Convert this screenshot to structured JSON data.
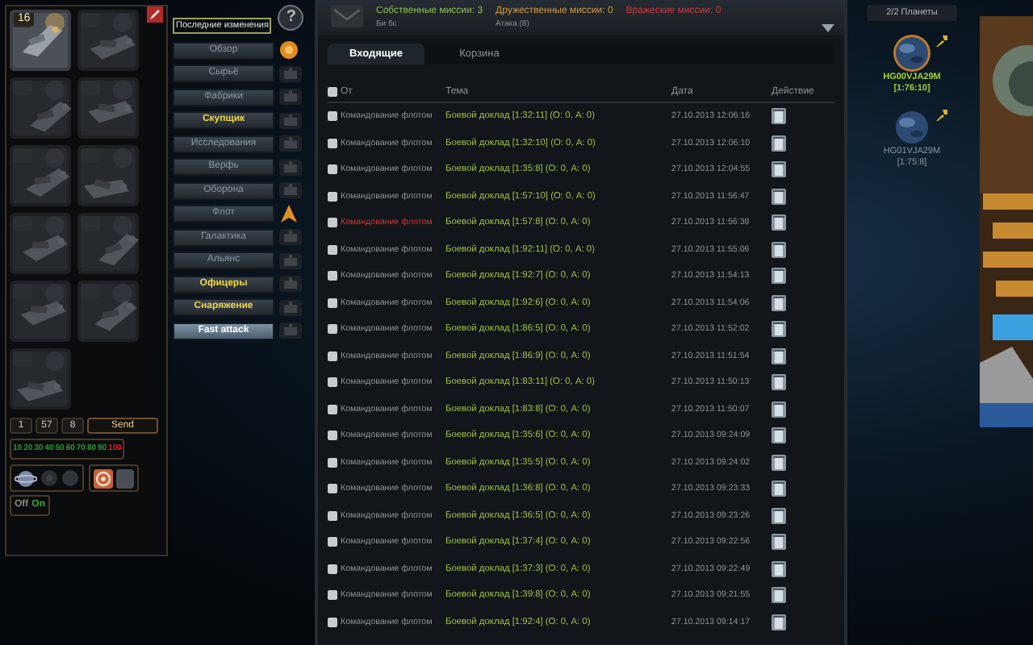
{
  "left_panel": {
    "thumbnails": [
      {
        "kind": "picture",
        "badge": "16"
      },
      {
        "kind": "picture"
      },
      {
        "kind": "picture"
      },
      {
        "kind": "picture"
      },
      {
        "kind": "picture"
      },
      {
        "kind": "picture"
      },
      {
        "kind": "picture"
      },
      {
        "kind": "picture"
      },
      {
        "kind": "picture"
      },
      {
        "kind": "picture"
      },
      {
        "kind": "picture"
      }
    ],
    "fleet_inputs": [
      {
        "value": "1"
      },
      {
        "value": "57"
      },
      {
        "value": "8"
      }
    ],
    "send_button": "Send",
    "percentages": [
      {
        "text": "10",
        "color": "#2e9a36"
      },
      {
        "text": "20",
        "color": "#2e9a36"
      },
      {
        "text": "30",
        "color": "#2e9a36"
      },
      {
        "text": "40",
        "color": "#2e9a36"
      },
      {
        "text": "50",
        "color": "#2e9a36"
      },
      {
        "text": "60",
        "color": "#2e9a36"
      },
      {
        "text": "70",
        "color": "#2e9a36"
      },
      {
        "text": "80",
        "color": "#2e9a36"
      },
      {
        "text": "90",
        "color": "#2e9a36"
      },
      {
        "text": "100",
        "color": "#e0242a"
      }
    ],
    "toggle": {
      "off_label": "Off",
      "on_label": "On",
      "on": true
    }
  },
  "menu": {
    "recent_changes": "Последние изменения",
    "help": "?",
    "items": [
      {
        "label": "Обзор",
        "kind": "normal"
      },
      {
        "label": "Сырьё",
        "kind": "normal"
      },
      {
        "label": "Фабрики",
        "kind": "normal"
      },
      {
        "label": "Скупщик",
        "kind": "highlight"
      },
      {
        "label": "Исследования",
        "kind": "normal"
      },
      {
        "label": "Верфь",
        "kind": "normal"
      },
      {
        "label": "Оборона",
        "kind": "normal"
      },
      {
        "label": "Флот",
        "kind": "normal"
      },
      {
        "label": "Галактика",
        "kind": "normal"
      },
      {
        "label": "Альянс",
        "kind": "normal"
      },
      {
        "label": "Офицеры",
        "kind": "highlight"
      },
      {
        "label": "Снаряжение",
        "kind": "highlight"
      },
      {
        "label": "Fast attack",
        "kind": "action"
      }
    ]
  },
  "missions": {
    "own": "Собственные миссии: 3",
    "own_detail": "Би бс",
    "friendly": "Дружественные миссии: 0",
    "friendly_detail": "Атака (8)",
    "hostile": "Вражеские миссии: 0"
  },
  "tabs": [
    {
      "label": "Входящие",
      "selected": true
    },
    {
      "label": "Корзина",
      "selected": false
    }
  ],
  "table": {
    "columns": [
      "От",
      "Тема",
      "Дата",
      "Действие"
    ],
    "all_checked": false,
    "rows": [
      {
        "checked": false,
        "flagged": false,
        "from": "Командование флотом",
        "subject": "Боевой доклад [1:32:11] (О: 0, А: 0)",
        "date": "27.10.2013 12:06:16"
      },
      {
        "checked": false,
        "flagged": false,
        "from": "Командование флотом",
        "subject": "Боевой доклад [1:32:10] (О: 0, А: 0)",
        "date": "27.10.2013 12:06:10"
      },
      {
        "checked": false,
        "flagged": false,
        "from": "Командование флотом",
        "subject": "Боевой доклад [1:35:8] (О: 0, А: 0)",
        "date": "27.10.2013 12:04:55"
      },
      {
        "checked": false,
        "flagged": false,
        "from": "Командование флотом",
        "subject": "Боевой доклад [1:57:10] (О: 0, А: 0)",
        "date": "27.10.2013 11:56:47"
      },
      {
        "checked": false,
        "flagged": true,
        "from": "Командование флотом",
        "subject": "Боевой доклад [1:57:8] (О: 0, А: 0)",
        "date": "27.10.2013 11:56:38"
      },
      {
        "checked": false,
        "flagged": false,
        "from": "Командование флотом",
        "subject": "Боевой доклад [1:92:11] (О: 0, А: 0)",
        "date": "27.10.2013 11:55:06"
      },
      {
        "checked": false,
        "flagged": false,
        "from": "Командование флотом",
        "subject": "Боевой доклад [1:92:7] (О: 0, А: 0)",
        "date": "27.10.2013 11:54:13"
      },
      {
        "checked": false,
        "flagged": false,
        "from": "Командование флотом",
        "subject": "Боевой доклад [1:92:6] (О: 0, А: 0)",
        "date": "27.10.2013 11:54:06"
      },
      {
        "checked": false,
        "flagged": false,
        "from": "Командование флотом",
        "subject": "Боевой доклад [1:86:5] (О: 0, А: 0)",
        "date": "27.10.2013 11:52:02"
      },
      {
        "checked": false,
        "flagged": false,
        "from": "Командование флотом",
        "subject": "Боевой доклад [1:86:9] (О: 0, А: 0)",
        "date": "27.10.2013 11:51:54"
      },
      {
        "checked": false,
        "flagged": false,
        "from": "Командование флотом",
        "subject": "Боевой доклад [1:83:11] (О: 0, А: 0)",
        "date": "27.10.2013 11:50:13"
      },
      {
        "checked": false,
        "flagged": false,
        "from": "Командование флотом",
        "subject": "Боевой доклад [1:83:8] (О: 0, А: 0)",
        "date": "27.10.2013 11:50:07"
      },
      {
        "checked": false,
        "flagged": false,
        "from": "Командование флотом",
        "subject": "Боевой доклад [1:35:6] (О: 0, А: 0)",
        "date": "27.10.2013 09:24:09"
      },
      {
        "checked": false,
        "flagged": false,
        "from": "Командование флотом",
        "subject": "Боевой доклад [1:35:5] (О: 0, А: 0)",
        "date": "27.10.2013 09:24:02"
      },
      {
        "checked": false,
        "flagged": false,
        "from": "Командование флотом",
        "subject": "Боевой доклад [1:36:8] (О: 0, А: 0)",
        "date": "27.10.2013 09:23:33"
      },
      {
        "checked": false,
        "flagged": false,
        "from": "Командование флотом",
        "subject": "Боевой доклад [1:36:5] (О: 0, А: 0)",
        "date": "27.10.2013 09:23:26"
      },
      {
        "checked": false,
        "flagged": false,
        "from": "Командование флотом",
        "subject": "Боевой доклад [1:37:4] (О: 0, А: 0)",
        "date": "27.10.2013 09:22:56"
      },
      {
        "checked": false,
        "flagged": false,
        "from": "Командование флотом",
        "subject": "Боевой доклад [1:37:3] (О: 0, А: 0)",
        "date": "27.10.2013 09:22:49"
      },
      {
        "checked": false,
        "flagged": false,
        "from": "Командование флотом",
        "subject": "Боевой доклад [1:39:8] (О: 0, А: 0)",
        "date": "27.10.2013 09:21:55"
      },
      {
        "checked": false,
        "flagged": false,
        "from": "Командование флотом",
        "subject": "Боевой доклад [1:92:4] (О: 0, А: 0)",
        "date": "27.10.2013 09:14:17"
      }
    ]
  },
  "planets": {
    "count": "2/2 Планеты",
    "items": [
      {
        "name": "HG00VJA29M",
        "coords": "[1:76:10]",
        "selected": true
      },
      {
        "name": "HG01VJA29M",
        "coords": "[1:75:8]",
        "selected": false
      }
    ]
  },
  "ad": {
    "kind": "picture"
  }
}
